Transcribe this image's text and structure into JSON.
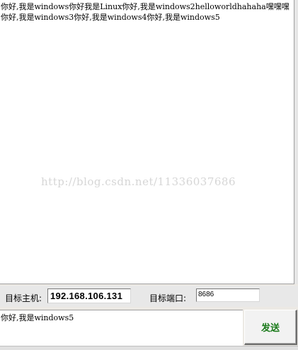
{
  "chat_log": {
    "lines": [
      "你好,我是windows你好我是Linux你好,我是windows2helloworldhahaha嘿嘿嘿",
      "你好,我是windows3你好,我是windows4你好,我是windows5"
    ],
    "watermark": "http://blog.csdn.net/11336037686"
  },
  "connection": {
    "host_label": "目标主机:",
    "host_value": "192.168.106.131",
    "port_label": "目标端口:",
    "port_value": "8686"
  },
  "composer": {
    "message": "你好,我是windows5",
    "send_label": "发送"
  }
}
